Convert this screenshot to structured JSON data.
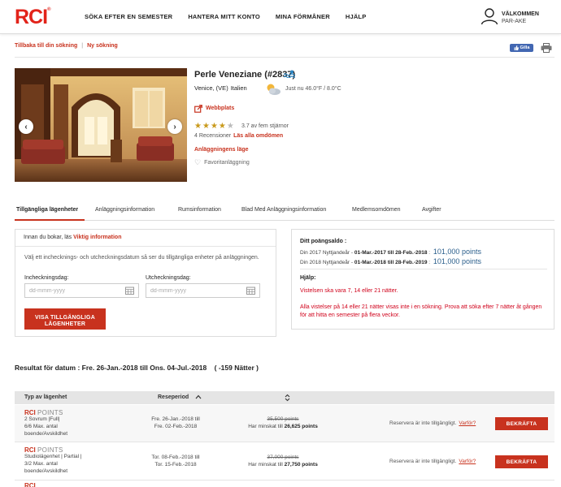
{
  "header": {
    "logo": "RCI",
    "logo_mark": "®",
    "nav": [
      "SÖKA EFTER EN SEMESTER",
      "HANTERA MITT KONTO",
      "MINA FÖRMÅNER",
      "HJÄLP"
    ],
    "welcome": "VÄLKOMMEN",
    "user": "PAR-AKE"
  },
  "breadcrumbs": {
    "back": "Tillbaka till din sökning",
    "separator": "|",
    "new_search": "Ny sökning",
    "share_label": "Gilla"
  },
  "resort": {
    "name": "Perle Veneziane (#2837)",
    "city": "Venice, (VE)",
    "country": "Italien",
    "weather": "Just nu 46.0°F / 8.0°C",
    "website": "Webbplats",
    "stars_filled": 4,
    "stars_total": 5,
    "rating_text": "3.7 av fem stjärnor",
    "reviews": "4 Recensioner",
    "read_all": "Läs alla omdömen",
    "location_link": "Anläggningens läge",
    "favorite": "Favoritanläggning"
  },
  "tabs": [
    "Tillgängliga lägenheter",
    "Anläggningsinformation",
    "Rumsinformation",
    "Blad Med Anläggningsinformation",
    "Medlemsomdömen",
    "Avgifter"
  ],
  "booking": {
    "notice_prefix": "Innan du bokar, läs",
    "notice_link": "Viktig information",
    "description": "Välj ett inchecknings- och utcheckningsdatum så ser du tillgängliga enheter på anläggningen.",
    "checkin_label": "Incheckningsdag:",
    "checkout_label": "Utcheckningsdag:",
    "date_placeholder": "dd-mmm-yyyy",
    "show_button": "VISA TILLGÄNGLIGA LÄGENHETER"
  },
  "points": {
    "title": "Ditt poängsaldo :",
    "rows": [
      {
        "prefix": "Din 2017 Nyttjandeår -",
        "range": "01-Mar.-2017 till 28-Feb.-2018",
        "sep": ":",
        "points": "101,000 points"
      },
      {
        "prefix": "Din 2018 Nyttjandeår -",
        "range": "01-Mar.-2018 till 28-Feb.-2019",
        "sep": ":",
        "points": "101,000 points"
      }
    ],
    "help_title": "Hjälp:",
    "help_1": "Vistelsen ska vara 7, 14 eller 21 nätter.",
    "help_2": "Alla vistelser på 14 eller 21 nätter visas inte i en sökning. Prova att söka efter 7 nätter åt gången för att hitta en semester på flera veckor."
  },
  "results": {
    "heading": "Resultat för datum : Fre. 26-Jan.-2018 till Ons. 04-Jul.-2018    ( -159 Nätter )",
    "col_type": "Typ av lägenhet",
    "col_period": "Reseperiod",
    "rows": [
      {
        "brand": "RCI",
        "brand_word": "POINTS",
        "unit": "2 Sovrum  |Full|",
        "capacity": "6/6 Max. antal",
        "capacity_2": "boende/Avskildhet",
        "from": "Fre. 26-Jan.-2018 till",
        "to": "Fre. 02-Feb.-2018",
        "old_points": "35,500 points",
        "reduced_label": "Har minskat till",
        "new_points": "26,625 points",
        "reserve": "Reservera är inte tillgängligt.",
        "why": "Varför?",
        "confirm": "BEKRÄFTA"
      },
      {
        "brand": "RCI",
        "brand_word": "POINTS",
        "unit": "Studiolägenhet  | Partial |",
        "capacity": "3/2 Max. antal",
        "capacity_2": "boende/Avskildhet",
        "from": "Tor. 08-Feb.-2018 till",
        "to": "Tor. 15-Feb.-2018",
        "old_points": "37,000 points",
        "reduced_label": "Har minskat till",
        "new_points": "27,750 points",
        "reserve": "Reservera är inte tillgängligt.",
        "why": "Varför?",
        "confirm": "BEKRÄFTA"
      }
    ]
  },
  "colors": {
    "brand_red": "#c8321e",
    "points_blue": "#2b5f8c",
    "alert_red": "#d0021b"
  }
}
